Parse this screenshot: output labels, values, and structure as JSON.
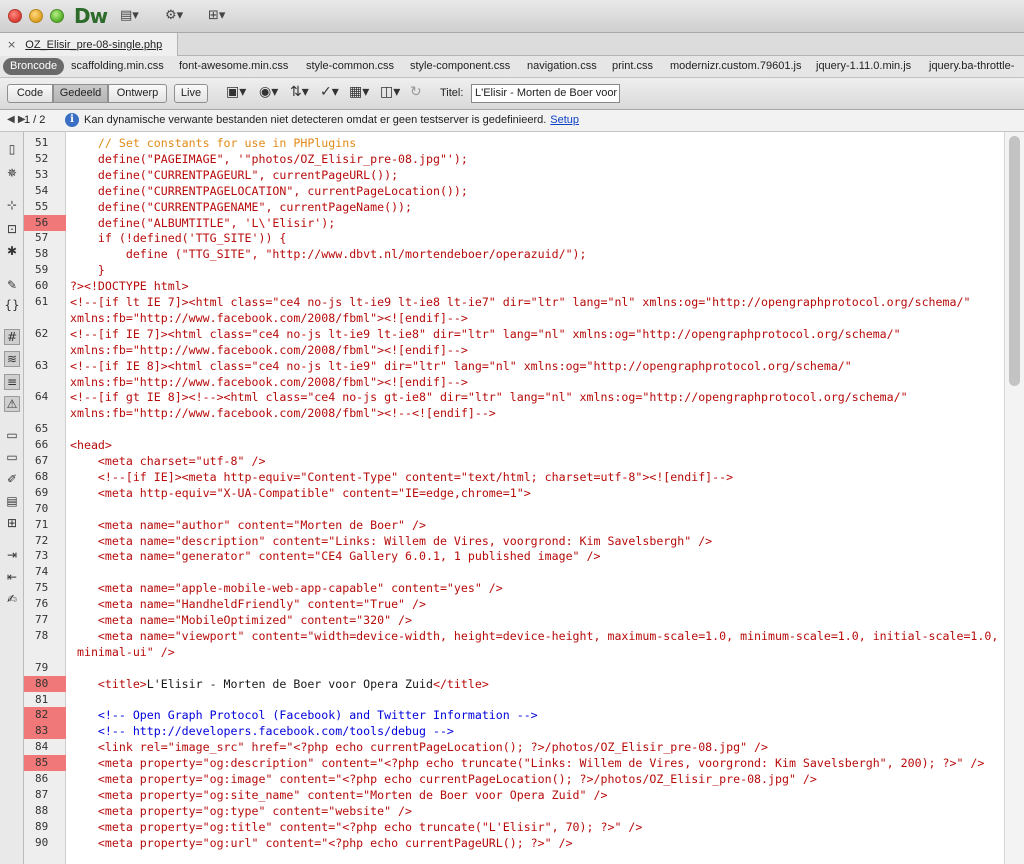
{
  "app": {
    "logo": "Dw"
  },
  "document_tab": {
    "filename": "OZ_Elisir_pre-08-single.php",
    "close_glyph": "×"
  },
  "related_files": {
    "source_label": "Broncode",
    "files": [
      "scaffolding.min.css",
      "font-awesome.min.css",
      "style-common.css",
      "style-component.css",
      "navigation.css",
      "print.css",
      "modernizr.custom.79601.js",
      "jquery-1.11.0.min.js",
      "jquery.ba-throttle-"
    ]
  },
  "toolbar": {
    "views": [
      "Code",
      "Gedeeld",
      "Ontwerp"
    ],
    "active_view": "Gedeeld",
    "live_label": "Live",
    "title_label": "Titel:",
    "title_value": "L'Elisir - Morten de Boer voor"
  },
  "infobar": {
    "page": "1 / 2",
    "message": "Kan dynamische verwante bestanden niet detecteren omdat er geen testserver is gedefinieerd.",
    "link": "Setup"
  },
  "code_lines": [
    {
      "n": "51",
      "segs": [
        {
          "t": "    // Set constants for use in PHPlugins",
          "c": "org"
        }
      ]
    },
    {
      "n": "52",
      "segs": [
        {
          "t": "    define(\"PAGEIMAGE\", '\"photos/OZ_Elisir_pre-08.jpg\"');",
          "c": "red"
        }
      ]
    },
    {
      "n": "53",
      "segs": [
        {
          "t": "    define(\"CURRENTPAGEURL\", currentPageURL());",
          "c": "red"
        }
      ]
    },
    {
      "n": "54",
      "segs": [
        {
          "t": "    define(\"CURRENTPAGELOCATION\", currentPageLocation());",
          "c": "red"
        }
      ]
    },
    {
      "n": "55",
      "segs": [
        {
          "t": "    define(\"CURRENTPAGENAME\", currentPageName());",
          "c": "red"
        }
      ]
    },
    {
      "n": "56",
      "mark": true,
      "segs": [
        {
          "t": "    define(\"ALBUMTITLE\", 'L\\'Elisir');",
          "c": "red"
        }
      ]
    },
    {
      "n": "57",
      "segs": [
        {
          "t": "    if (!defined('TTG_SITE')) {",
          "c": "red"
        }
      ]
    },
    {
      "n": "58",
      "segs": [
        {
          "t": "        define (\"TTG_SITE\", \"http://www.dbvt.nl/mortendeboer/operazuid/\");",
          "c": "red"
        }
      ]
    },
    {
      "n": "59",
      "segs": [
        {
          "t": "    }",
          "c": "red"
        }
      ]
    },
    {
      "n": "60",
      "segs": [
        {
          "t": "?><!DOCTYPE html>",
          "c": "red"
        }
      ]
    },
    {
      "n": "61",
      "segs": [
        {
          "t": "<!--[if lt IE 7]><html class=\"ce4 no-js lt-ie9 lt-ie8 lt-ie7\" dir=\"ltr\" lang=\"nl\" xmlns:og=\"http://opengraphprotocol.org/schema/\"",
          "c": "red"
        }
      ]
    },
    {
      "n": "",
      "segs": [
        {
          "t": "xmlns:fb=\"http://www.facebook.com/2008/fbml\"><![endif]-->",
          "c": "red"
        }
      ]
    },
    {
      "n": "62",
      "segs": [
        {
          "t": "<!--[if IE 7]><html class=\"ce4 no-js lt-ie9 lt-ie8\" dir=\"ltr\" lang=\"nl\" xmlns:og=\"http://opengraphprotocol.org/schema/\"",
          "c": "red"
        }
      ]
    },
    {
      "n": "",
      "segs": [
        {
          "t": "xmlns:fb=\"http://www.facebook.com/2008/fbml\"><![endif]-->",
          "c": "red"
        }
      ]
    },
    {
      "n": "63",
      "segs": [
        {
          "t": "<!--[if IE 8]><html class=\"ce4 no-js lt-ie9\" dir=\"ltr\" lang=\"nl\" xmlns:og=\"http://opengraphprotocol.org/schema/\"",
          "c": "red"
        }
      ]
    },
    {
      "n": "",
      "segs": [
        {
          "t": "xmlns:fb=\"http://www.facebook.com/2008/fbml\"><![endif]-->",
          "c": "red"
        }
      ]
    },
    {
      "n": "64",
      "segs": [
        {
          "t": "<!--[if gt IE 8]><!--><html class=\"ce4 no-js gt-ie8\" dir=\"ltr\" lang=\"nl\" xmlns:og=\"http://opengraphprotocol.org/schema/\"",
          "c": "red"
        }
      ]
    },
    {
      "n": "",
      "segs": [
        {
          "t": "xmlns:fb=\"http://www.facebook.com/2008/fbml\"><!--<![endif]-->",
          "c": "red"
        }
      ]
    },
    {
      "n": "65",
      "segs": []
    },
    {
      "n": "66",
      "segs": [
        {
          "t": "<head>",
          "c": "red"
        }
      ]
    },
    {
      "n": "67",
      "segs": [
        {
          "t": "    <meta charset=\"utf-8\" />",
          "c": "red"
        }
      ]
    },
    {
      "n": "68",
      "segs": [
        {
          "t": "    <!--[if IE]><meta http-equiv=\"Content-Type\" content=\"text/html; charset=utf-8\"><![endif]-->",
          "c": "red"
        }
      ]
    },
    {
      "n": "69",
      "segs": [
        {
          "t": "    <meta http-equiv=\"X-UA-Compatible\" content=\"IE=edge,chrome=1\">",
          "c": "red"
        }
      ]
    },
    {
      "n": "70",
      "segs": []
    },
    {
      "n": "71",
      "segs": [
        {
          "t": "    <meta name=\"author\" content=\"Morten de Boer\" />",
          "c": "red"
        }
      ]
    },
    {
      "n": "72",
      "segs": [
        {
          "t": "    <meta name=\"description\" content=\"Links: Willem de Vires, voorgrond: Kim Savelsbergh\" />",
          "c": "red"
        }
      ]
    },
    {
      "n": "73",
      "segs": [
        {
          "t": "    <meta name=\"generator\" content=\"CE4 Gallery 6.0.1, 1 published image\" />",
          "c": "red"
        }
      ]
    },
    {
      "n": "74",
      "segs": []
    },
    {
      "n": "75",
      "segs": [
        {
          "t": "    <meta name=\"apple-mobile-web-app-capable\" content=\"yes\" />",
          "c": "red"
        }
      ]
    },
    {
      "n": "76",
      "segs": [
        {
          "t": "    <meta name=\"HandheldFriendly\" content=\"True\" />",
          "c": "red"
        }
      ]
    },
    {
      "n": "77",
      "segs": [
        {
          "t": "    <meta name=\"MobileOptimized\" content=\"320\" />",
          "c": "red"
        }
      ]
    },
    {
      "n": "78",
      "segs": [
        {
          "t": "    <meta name=\"viewport\" content=\"width=device-width, height=device-height, maximum-scale=1.0, minimum-scale=1.0, initial-scale=1.0,",
          "c": "red"
        }
      ]
    },
    {
      "n": "",
      "segs": [
        {
          "t": " minimal-ui\" />",
          "c": "red"
        }
      ]
    },
    {
      "n": "79",
      "segs": []
    },
    {
      "n": "80",
      "mark": true,
      "segs": [
        {
          "t": "    <title>",
          "c": "red"
        },
        {
          "t": "L'Elisir - Morten de Boer voor Opera Zuid",
          "c": "dark"
        },
        {
          "t": "</title>",
          "c": "red"
        }
      ]
    },
    {
      "n": "81",
      "segs": []
    },
    {
      "n": "82",
      "mark": true,
      "segs": [
        {
          "t": "    <!-- Open Graph Protocol (Facebook) and Twitter Information -->",
          "c": "blue"
        }
      ]
    },
    {
      "n": "83",
      "mark": true,
      "segs": [
        {
          "t": "    <!-- http://developers.facebook.com/tools/debug -->",
          "c": "blue"
        }
      ]
    },
    {
      "n": "84",
      "segs": [
        {
          "t": "    <link rel=\"image_src\" href=\"<?php echo currentPageLocation(); ?>/photos/OZ_Elisir_pre-08.jpg\" />",
          "c": "red"
        }
      ]
    },
    {
      "n": "85",
      "mark": true,
      "segs": [
        {
          "t": "    <meta property=\"og:description\" content=\"<?php echo truncate(\"Links: Willem de Vires, voorgrond: Kim Savelsbergh\", 200); ?>\" />",
          "c": "red"
        }
      ]
    },
    {
      "n": "86",
      "segs": [
        {
          "t": "    <meta property=\"og:image\" content=\"<?php echo currentPageLocation(); ?>/photos/OZ_Elisir_pre-08.jpg\" />",
          "c": "red"
        }
      ]
    },
    {
      "n": "87",
      "segs": [
        {
          "t": "    <meta property=\"og:site_name\" content=\"Morten de Boer voor Opera Zuid\" />",
          "c": "red"
        }
      ]
    },
    {
      "n": "88",
      "segs": [
        {
          "t": "    <meta property=\"og:type\" content=\"website\" />",
          "c": "red"
        }
      ]
    },
    {
      "n": "89",
      "segs": [
        {
          "t": "    <meta property=\"og:title\" content=\"<?php echo truncate(\"L'Elisir\", 70); ?>\" />",
          "c": "red"
        }
      ]
    },
    {
      "n": "90",
      "segs": [
        {
          "t": "    <meta property=\"og:url\" content=\"<?php echo currentPageURL(); ?>\" />",
          "c": "red"
        }
      ]
    }
  ]
}
